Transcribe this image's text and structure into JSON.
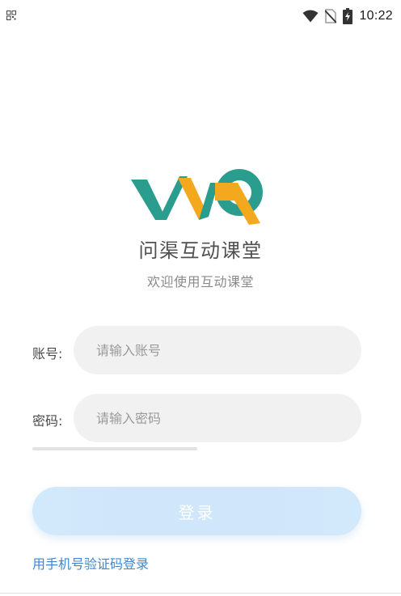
{
  "status_bar": {
    "time": "10:22",
    "icons": [
      "qr-scan-icon",
      "wifi-icon",
      "no-sim-icon",
      "battery-charging-icon"
    ]
  },
  "app": {
    "name": "问渠互动课堂",
    "slogan": "欢迎使用互动课堂",
    "logo": {
      "letters": "WQ",
      "colors": {
        "teal": "#2a9d8f",
        "orange": "#f4a81d"
      }
    }
  },
  "form": {
    "account": {
      "label": "账号:",
      "placeholder": "请输入账号",
      "value": ""
    },
    "password": {
      "label": "密码:",
      "placeholder": "请输入密码",
      "value": ""
    }
  },
  "login_button": {
    "label": "登录",
    "color": "#cfe6fb"
  },
  "sms_login_link": {
    "label": "用手机号验证码登录",
    "color": "#3f86cf"
  }
}
